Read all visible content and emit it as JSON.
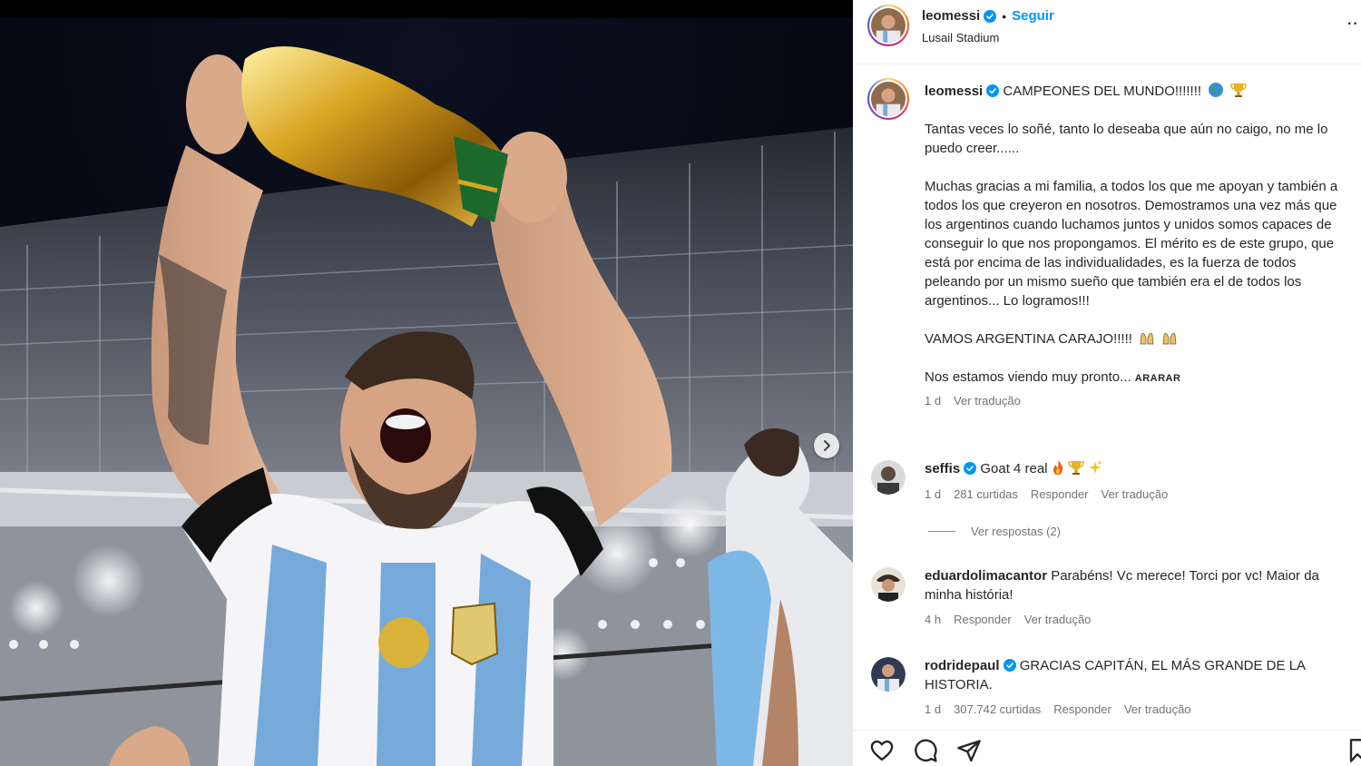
{
  "post": {
    "username": "leomessi",
    "follow_label": "Seguir",
    "separator": "•",
    "location": "Lusail Stadium",
    "more_icon": "more-options-icon"
  },
  "caption": {
    "username": "leomessi",
    "first_line": "CAMPEONES DEL MUNDO!!!!!!!",
    "paragraph_1": "Tantas veces lo soñé, tanto lo deseaba que aún no caigo, no me lo puedo creer......",
    "paragraph_2": "Muchas gracias a mi familia, a todos los que me apoyan y también a todos los que creyeron en nosotros. Demostramos una vez más que los argentinos cuando luchamos juntos y unidos somos capaces de conseguir lo que nos propongamos. El mérito es de este grupo, que está por encima de las individualidades, es la fuerza de todos peleando por un mismo sueño que también era el de todos los argentinos... Lo logramos!!!",
    "paragraph_3": "VAMOS ARGENTINA CARAJO!!!!!",
    "paragraph_4": "Nos estamos viendo muy pronto...",
    "tag": "ARARAR",
    "time": "1 d",
    "translate": "Ver tradução"
  },
  "comments": [
    {
      "username": "seffis",
      "verified": true,
      "text": "Goat 4 real",
      "time": "1 d",
      "likes": "281 curtidas",
      "reply": "Responder",
      "translate": "Ver tradução",
      "view_replies": "Ver respostas (2)"
    },
    {
      "username": "eduardolimacantor",
      "verified": false,
      "text": "Parabéns! Vc merece! Torci por vc! Maior da minha história!",
      "time": "4 h",
      "reply": "Responder",
      "translate": "Ver tradução"
    },
    {
      "username": "rodridepaul",
      "verified": true,
      "text": "GRACIAS CAPITÁN, EL MÁS GRANDE DE LA HISTORIA.",
      "time": "1 d",
      "likes": "307.742 curtidas",
      "reply": "Responder",
      "translate": "Ver tradução"
    }
  ],
  "actions": [
    "heart-icon",
    "comment-icon",
    "share-icon",
    "save-icon"
  ],
  "colors": {
    "accent": "#0095f6",
    "text": "#262626",
    "secondary": "#737373",
    "verified": "#0095f6",
    "jersey_blue": "#75aadb"
  }
}
